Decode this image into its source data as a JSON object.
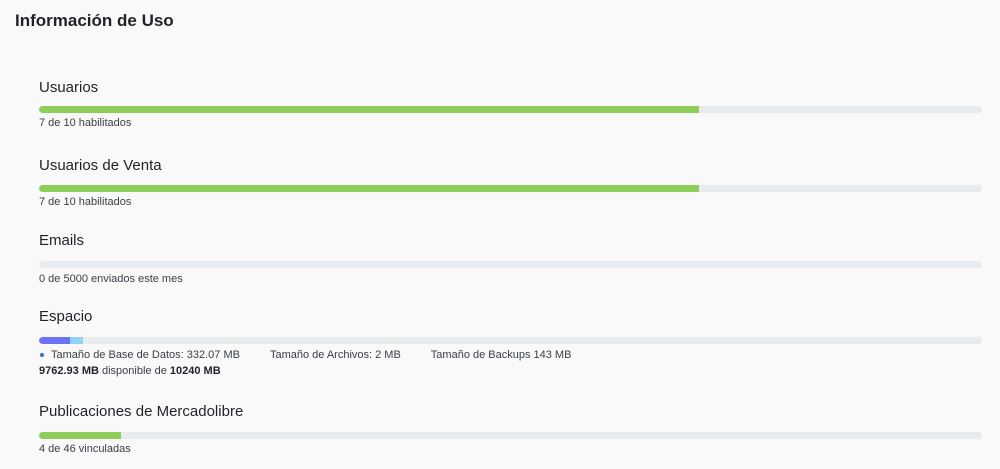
{
  "page_title": "Información de Uso",
  "colors": {
    "usage_fill": "#8fcd5a",
    "track": "#e9ecef",
    "db_fill": "#6d71f5",
    "files_fill": "#8fd3f5",
    "legend_dot": "#2f74c6"
  },
  "sections": {
    "usuarios": {
      "title": "Usuarios",
      "caption": "7 de 10 habilitados",
      "used": 7,
      "total": 10
    },
    "usuarios_venta": {
      "title": "Usuarios de Venta",
      "caption": "7 de 10 habilitados",
      "used": 7,
      "total": 10
    },
    "emails": {
      "title": "Emails",
      "caption": "0 de 5000 enviados este mes",
      "used": 0,
      "total": 5000
    },
    "espacio": {
      "title": "Espacio",
      "db_label": "Tamaño de Base de Datos: 332.07 MB",
      "files_label": "Tamaño de Archivos: 2 MB",
      "backups_label": "Tamaño de Backups 143 MB",
      "available_value": "9762.93 MB",
      "available_text": "disponible de",
      "total_value": "10240 MB",
      "db_mb": 332.07,
      "files_mb": 2,
      "backups_mb": 143,
      "total_mb": 10240
    },
    "mercadolibre": {
      "title": "Publicaciones de Mercadolibre",
      "caption": "4 de 46 vinculadas",
      "used": 4,
      "total": 46
    }
  }
}
